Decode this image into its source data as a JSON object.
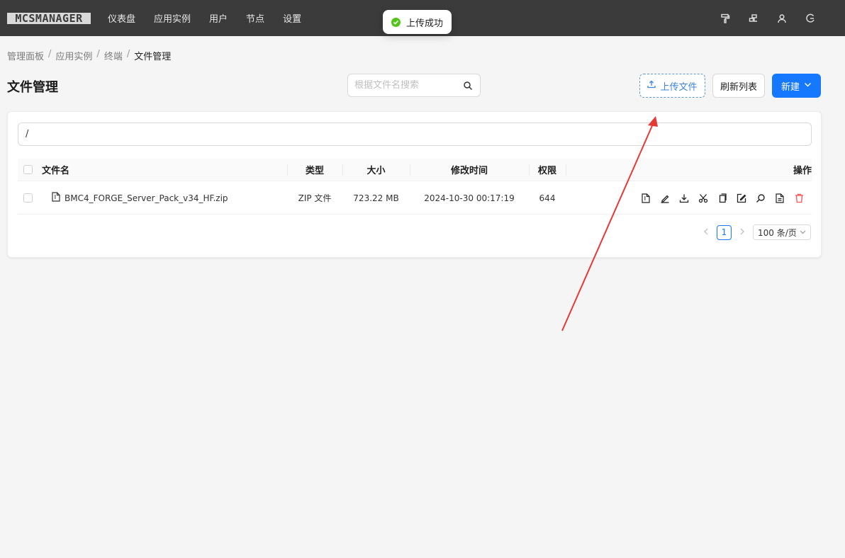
{
  "logo": {
    "text": "MCSMANAGER"
  },
  "nav": {
    "items": [
      {
        "label": "仪表盘"
      },
      {
        "label": "应用实例"
      },
      {
        "label": "用户"
      },
      {
        "label": "节点"
      },
      {
        "label": "设置"
      }
    ],
    "right_icons": [
      "paint-roller-icon",
      "cluster-icon",
      "user-icon",
      "logout-icon"
    ]
  },
  "toast": {
    "message": "上传成功",
    "status_color": "#52c41a"
  },
  "breadcrumb": {
    "items": [
      {
        "label": "管理面板"
      },
      {
        "label": "应用实例"
      },
      {
        "label": "终端"
      },
      {
        "label": "文件管理"
      }
    ],
    "separator": "/"
  },
  "header": {
    "title": "文件管理",
    "search_placeholder": "根据文件名搜索",
    "upload_label": "上传文件",
    "refresh_label": "刷新列表",
    "new_label": "新建"
  },
  "file_browser": {
    "path": "/",
    "columns": {
      "name": "文件名",
      "type": "类型",
      "size": "大小",
      "mtime": "修改时间",
      "perm": "权限",
      "actions": "操作"
    },
    "rows": [
      {
        "name": "BMC4_FORGE_Server_Pack_v34_HF.zip",
        "type": "ZIP 文件",
        "size": "723.22 MB",
        "mtime": "2024-10-30 00:17:19",
        "perm": "644"
      }
    ],
    "row_actions": [
      "file-icon",
      "rename-icon",
      "download-icon",
      "cut-icon",
      "copy-icon",
      "edit-icon",
      "search-icon",
      "file-info-icon",
      "delete-icon"
    ]
  },
  "pagination": {
    "current_page": "1",
    "page_size": "100 条/页"
  },
  "colors": {
    "primary": "#1677ff",
    "topbar": "#3b3b3b",
    "danger": "#ff4d4f",
    "annotation": "#e53935"
  }
}
